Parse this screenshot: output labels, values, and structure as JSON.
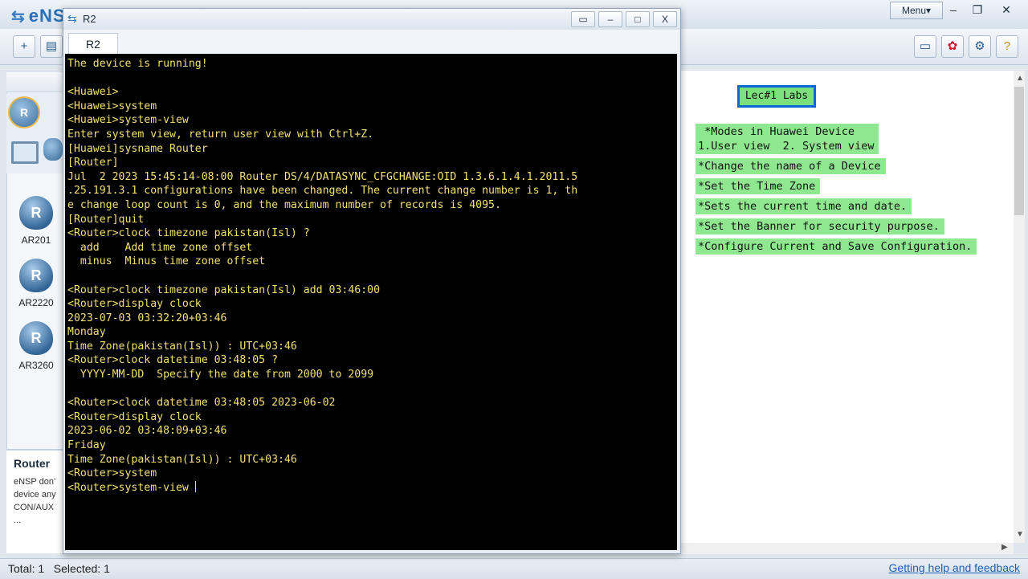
{
  "app": {
    "logo_text": "eNS",
    "menu_label": "Menu▾",
    "win_controls": [
      "–",
      "❐",
      "✕"
    ]
  },
  "toolbar": {
    "right_icons": [
      "chat-icon",
      "huawei-logo-icon",
      "settings-icon",
      "help-icon"
    ]
  },
  "left_panel": {
    "header_letter": "R",
    "devices": [
      {
        "label": "AR201"
      },
      {
        "label": "AR2220"
      },
      {
        "label": "AR3260"
      }
    ],
    "info_title": "Router",
    "info_text": "eNSP don'\ndevice any\nCON/AUX\n..."
  },
  "status_bar": {
    "text": "Total: 1   Selected: 1",
    "help_link": "Getting help and feedback"
  },
  "window": {
    "title": "R2",
    "tab_label": "R2",
    "controls": [
      "▭",
      "–",
      "□",
      "X"
    ]
  },
  "console": {
    "lines": [
      "The device is running!",
      "",
      "<Huawei>",
      "<Huawei>system",
      "<Huawei>system-view",
      "Enter system view, return user view with Ctrl+Z.",
      "[Huawei]sysname Router",
      "[Router]",
      "Jul  2 2023 15:45:14-08:00 Router DS/4/DATASYNC_CFGCHANGE:OID 1.3.6.1.4.1.2011.5",
      ".25.191.3.1 configurations have been changed. The current change number is 1, th",
      "e change loop count is 0, and the maximum number of records is 4095.",
      "[Router]quit",
      "<Router>clock timezone pakistan(Isl) ?",
      "  add    Add time zone offset",
      "  minus  Minus time zone offset",
      "",
      "<Router>clock timezone pakistan(Isl) add 03:46:00",
      "<Router>display clock",
      "2023-07-03 03:32:20+03:46",
      "Monday",
      "Time Zone(pakistan(Isl)) : UTC+03:46",
      "<Router>clock datetime 03:48:05 ?",
      "  YYYY-MM-DD  Specify the date from 2000 to 2099",
      "",
      "<Router>clock datetime 03:48:05 2023-06-02",
      "<Router>display clock",
      "2023-06-02 03:48:09+03:46",
      "Friday",
      "Time Zone(pakistan(Isl)) : UTC+03:46",
      "<Router>system",
      "<Router>system-view "
    ]
  },
  "notes": {
    "title": "Lec#1 Labs",
    "items": [
      " *Modes in Huawei Device\n1.User view  2. System view",
      "*Change the name of a Device",
      "*Set the Time Zone",
      "*Sets the current time and date.",
      "*Set the Banner for security purpose.",
      "*Configure Current and Save Configuration."
    ]
  }
}
